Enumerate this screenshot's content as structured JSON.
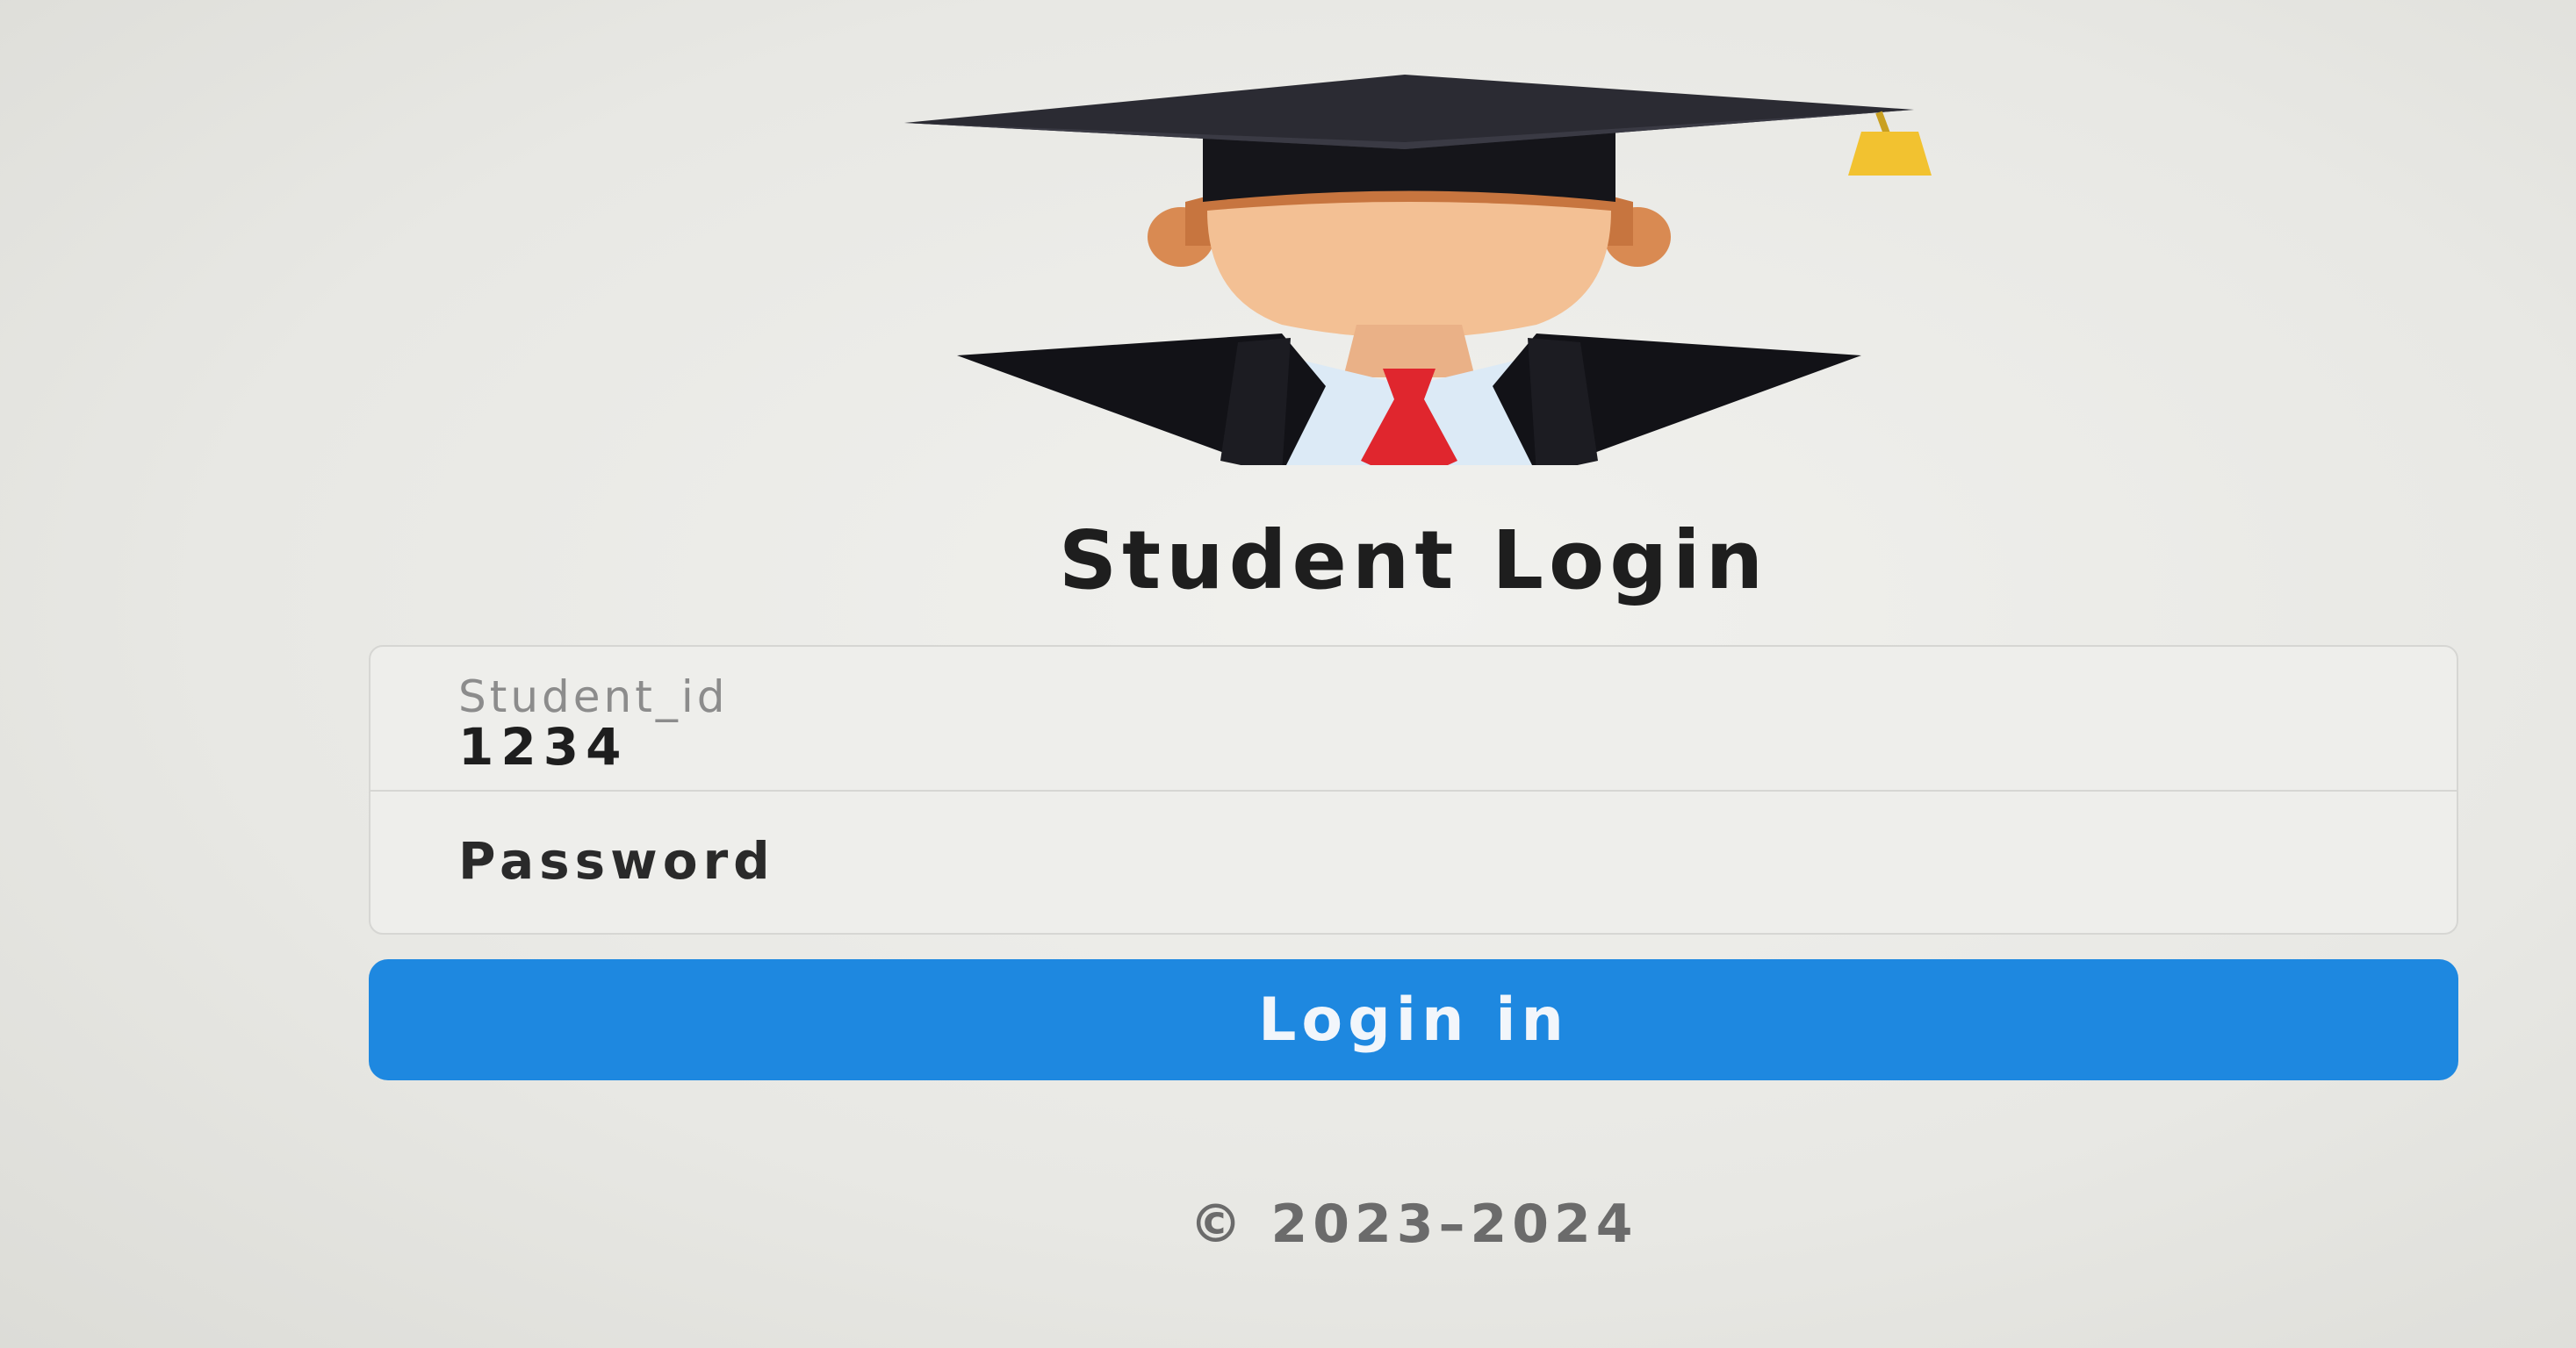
{
  "page": {
    "title": "Student Login"
  },
  "logo": {
    "icon": "graduate-student-icon"
  },
  "form": {
    "student_id": {
      "label": "Student_id",
      "value": "1234"
    },
    "password": {
      "placeholder": "Password",
      "value": ""
    },
    "submit_label": "Login in"
  },
  "footer": {
    "copyright": "© 2023–2024"
  },
  "colors": {
    "button": "#1e88e0",
    "background": "#e9e9e6",
    "tie": "#e0262e",
    "tassel": "#f2c230"
  }
}
